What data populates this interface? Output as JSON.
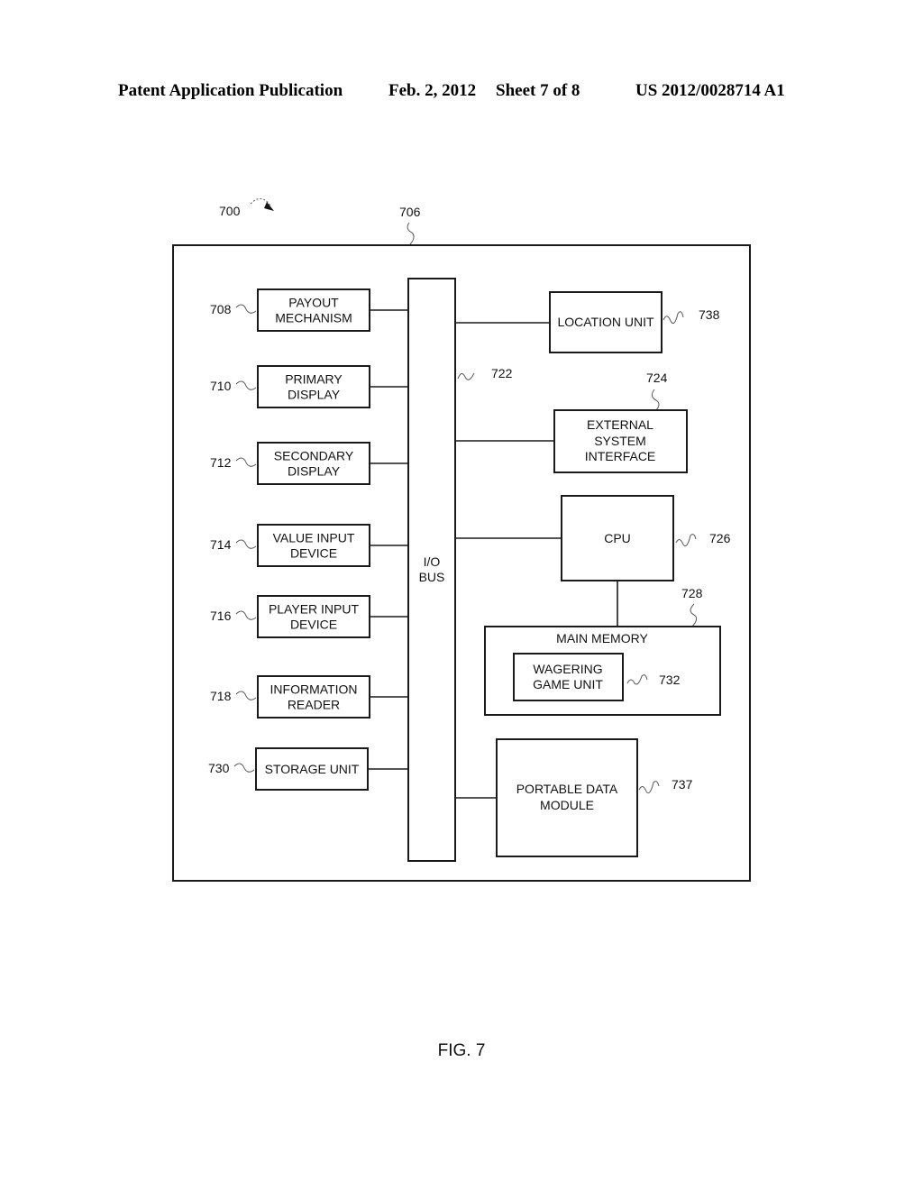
{
  "header": {
    "publication": "Patent Application Publication",
    "date": "Feb. 2, 2012",
    "sheet": "Sheet 7 of 8",
    "number": "US 2012/0028714 A1"
  },
  "figure": {
    "caption": "FIG. 7",
    "system_ref": "700",
    "enclosure_ref": "706",
    "bus": {
      "lines": [
        "I/O",
        "BUS"
      ],
      "ref": "722"
    },
    "left_components": [
      {
        "lines": [
          "PAYOUT",
          "MECHANISM"
        ],
        "ref": "708"
      },
      {
        "lines": [
          "PRIMARY",
          "DISPLAY"
        ],
        "ref": "710"
      },
      {
        "lines": [
          "SECONDARY",
          "DISPLAY"
        ],
        "ref": "712"
      },
      {
        "lines": [
          "VALUE INPUT",
          "DEVICE"
        ],
        "ref": "714"
      },
      {
        "lines": [
          "PLAYER INPUT",
          "DEVICE"
        ],
        "ref": "716"
      },
      {
        "lines": [
          "INFORMATION",
          "READER"
        ],
        "ref": "718"
      },
      {
        "lines": [
          "STORAGE UNIT"
        ],
        "ref": "730"
      }
    ],
    "right_components": {
      "location_unit": {
        "lines": [
          "LOCATION UNIT"
        ],
        "ref": "738"
      },
      "external_interface": {
        "lines": [
          "EXTERNAL",
          "SYSTEM",
          "INTERFACE"
        ],
        "ref": "724"
      },
      "cpu": {
        "lines": [
          "CPU"
        ],
        "ref": "726"
      },
      "main_memory": {
        "lines": [
          "MAIN MEMORY"
        ],
        "ref": "728"
      },
      "wagering_game_unit": {
        "lines": [
          "WAGERING",
          "GAME UNIT"
        ],
        "ref": "732"
      },
      "portable_data_module": {
        "lines": [
          "PORTABLE DATA",
          "MODULE"
        ],
        "ref": "737"
      }
    }
  }
}
